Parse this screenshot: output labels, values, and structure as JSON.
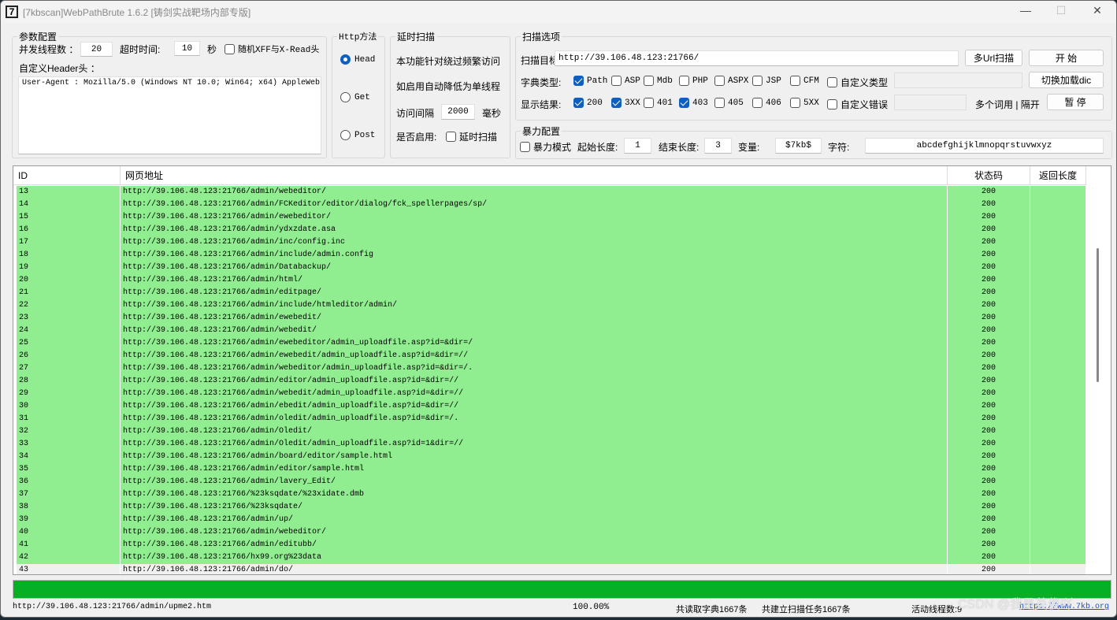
{
  "window": {
    "title": "[7kbscan]WebPathBrute 1.6.2 [铸剑实战靶场内部专版]",
    "icon": "7",
    "minimize": "—",
    "maximize": "☐",
    "close": "✕"
  },
  "params": {
    "legend": "参数配置",
    "threads_label": "并发线程数 ：",
    "threads": "20",
    "timeout_label": "超时时间:",
    "timeout": "10",
    "sec": "秒",
    "xff_label": "随机XFF与X-Read头",
    "xff_checked": false,
    "header_label": "自定义Header头 ：",
    "header_value": "User-Agent : Mozilla/5.0 (Windows NT 10.0; Win64; x64) AppleWebl"
  },
  "http": {
    "legend": "Http方法",
    "methods": [
      {
        "label": "Head",
        "selected": true
      },
      {
        "label": "Get",
        "selected": false
      },
      {
        "label": "Post",
        "selected": false
      }
    ]
  },
  "delay": {
    "legend": "延时扫描",
    "line1": "本功能针对绕过频繁访问",
    "line2": "如启用自动降低为单线程",
    "interval_label": "访问间隔",
    "interval": "2000",
    "ms": "毫秒",
    "enable_label": "是否启用:",
    "enable_cb": "延时扫描",
    "enabled": false
  },
  "scan": {
    "legend": "扫描选项",
    "target_label": "扫描目标:",
    "target": "http://39.106.48.123:21766/",
    "multi_url": "多Url扫描",
    "start": "开 始",
    "dict_label": "字典类型:",
    "dict_types": [
      {
        "label": "Path",
        "checked": true
      },
      {
        "label": "ASP",
        "checked": false
      },
      {
        "label": "Mdb",
        "checked": false
      },
      {
        "label": "PHP",
        "checked": false
      },
      {
        "label": "ASPX",
        "checked": false
      },
      {
        "label": "JSP",
        "checked": false
      },
      {
        "label": "CFM",
        "checked": false
      },
      {
        "label": "自定义类型",
        "checked": false
      }
    ],
    "switch_dic": "切换加载dic",
    "result_label": "显示结果:",
    "results": [
      {
        "label": "200",
        "checked": true
      },
      {
        "label": "3XX",
        "checked": true
      },
      {
        "label": "401",
        "checked": false
      },
      {
        "label": "403",
        "checked": true
      },
      {
        "label": "405",
        "checked": false
      },
      {
        "label": "406",
        "checked": false
      },
      {
        "label": "5XX",
        "checked": false
      },
      {
        "label": "自定义错误",
        "checked": false
      }
    ],
    "multi_word": "多个词用 | 隔开",
    "pause": "暂 停"
  },
  "brute": {
    "legend": "暴力配置",
    "mode": "暴力模式",
    "mode_checked": false,
    "start_len_label": "起始长度:",
    "start_len": "1",
    "end_len_label": "结束长度:",
    "end_len": "3",
    "var_label": "变量:",
    "var": "$7kb$",
    "chars_label": "字符:",
    "chars": "abcdefghijklmnopqrstuvwxyz"
  },
  "table": {
    "headers": [
      "ID",
      "网页地址",
      "状态码",
      "返回长度"
    ],
    "rows": [
      [
        "13",
        "http://39.106.48.123:21766/admin/webeditor/",
        "200"
      ],
      [
        "14",
        "http://39.106.48.123:21766/admin/FCKeditor/editor/dialog/fck_spellerpages/sp/",
        "200"
      ],
      [
        "15",
        "http://39.106.48.123:21766/admin/ewebeditor/",
        "200"
      ],
      [
        "16",
        "http://39.106.48.123:21766/admin/ydxzdate.asa",
        "200"
      ],
      [
        "17",
        "http://39.106.48.123:21766/admin/inc/config.inc",
        "200"
      ],
      [
        "18",
        "http://39.106.48.123:21766/admin/include/admin.config",
        "200"
      ],
      [
        "19",
        "http://39.106.48.123:21766/admin/Databackup/",
        "200"
      ],
      [
        "20",
        "http://39.106.48.123:21766/admin/html/",
        "200"
      ],
      [
        "21",
        "http://39.106.48.123:21766/admin/editpage/",
        "200"
      ],
      [
        "22",
        "http://39.106.48.123:21766/admin/include/htmleditor/admin/",
        "200"
      ],
      [
        "23",
        "http://39.106.48.123:21766/admin/ewebedit/",
        "200"
      ],
      [
        "24",
        "http://39.106.48.123:21766/admin/webedit/",
        "200"
      ],
      [
        "25",
        "http://39.106.48.123:21766/admin/ewebeditor/admin_uploadfile.asp?id=&dir=/",
        "200"
      ],
      [
        "26",
        "http://39.106.48.123:21766/admin/ewebedit/admin_uploadfile.asp?id=&dir=//",
        "200"
      ],
      [
        "27",
        "http://39.106.48.123:21766/admin/webeditor/admin_uploadfile.asp?id=&dir=/.",
        "200"
      ],
      [
        "28",
        "http://39.106.48.123:21766/admin/editor/admin_uploadfile.asp?id=&dir=//",
        "200"
      ],
      [
        "29",
        "http://39.106.48.123:21766/admin/webedit/admin_uploadfile.asp?id=&dir=//",
        "200"
      ],
      [
        "30",
        "http://39.106.48.123:21766/admin/ebedit/admin_uploadfile.asp?id=&dir=//",
        "200"
      ],
      [
        "31",
        "http://39.106.48.123:21766/admin/oledit/admin_uploadfile.asp?id=&dir=/.",
        "200"
      ],
      [
        "32",
        "http://39.106.48.123:21766/admin/Oledit/",
        "200"
      ],
      [
        "33",
        "http://39.106.48.123:21766/admin/Oledit/admin_uploadfile.asp?id=1&dir=//",
        "200"
      ],
      [
        "34",
        "http://39.106.48.123:21766/admin/board/editor/sample.html",
        "200"
      ],
      [
        "35",
        "http://39.106.48.123:21766/admin/editor/sample.html",
        "200"
      ],
      [
        "36",
        "http://39.106.48.123:21766/admin/lavery_Edit/",
        "200"
      ],
      [
        "37",
        "http://39.106.48.123:21766/%23ksqdate/%23xidate.dmb",
        "200"
      ],
      [
        "38",
        "http://39.106.48.123:21766/%23ksqdate/",
        "200"
      ],
      [
        "39",
        "http://39.106.48.123:21766/admin/up/",
        "200"
      ],
      [
        "40",
        "http://39.106.48.123:21766/admin/webeditor/",
        "200"
      ],
      [
        "41",
        "http://39.106.48.123:21766/admin/editubb/",
        "200"
      ],
      [
        "42",
        "http://39.106.48.123:21766/hx99.org%23data",
        "200"
      ],
      [
        "43",
        "http://39.106.48.123:21766/admin/do/",
        "200"
      ]
    ],
    "highlight_color": "#90ee90"
  },
  "progress": {
    "percent": 100,
    "color": "#06b025"
  },
  "statusbar": {
    "current": "http://39.106.48.123:21766/admin/upme2.htm",
    "percent": "100.00%",
    "dict_count": "共读取字典1667条",
    "task_count": "共建立扫描任务1667条",
    "threads": "活动线程数:9",
    "link": "https://www.7kb.org"
  },
  "watermark": "CSDN @我是英俊吖"
}
